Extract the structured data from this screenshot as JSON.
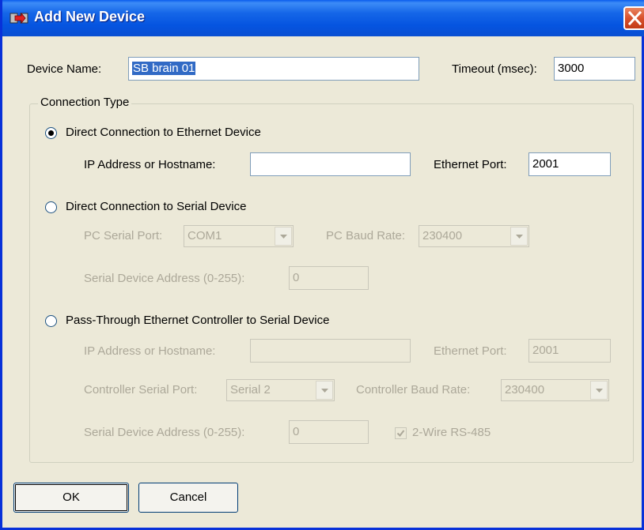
{
  "window": {
    "title": "Add New Device"
  },
  "device": {
    "name_label": "Device Name:",
    "name_value": "SB brain 01",
    "timeout_label": "Timeout (msec):",
    "timeout_value": "3000"
  },
  "connection_group": {
    "legend": "Connection Type",
    "direct_ethernet": {
      "label": "Direct Connection to Ethernet Device",
      "selected": true,
      "ip_label": "IP Address or Hostname:",
      "ip_value": "",
      "port_label": "Ethernet Port:",
      "port_value": "2001"
    },
    "direct_serial": {
      "label": "Direct Connection to Serial Device",
      "selected": false,
      "pc_port_label": "PC Serial Port:",
      "pc_port_value": "COM1",
      "baud_label": "PC Baud Rate:",
      "baud_value": "230400",
      "address_label": "Serial Device Address (0-255):",
      "address_value": "0"
    },
    "pass_through": {
      "label": "Pass-Through Ethernet Controller to Serial Device",
      "selected": false,
      "ip_label": "IP Address or Hostname:",
      "ip_value": "",
      "port_label": "Ethernet Port:",
      "port_value": "2001",
      "ctrl_port_label": "Controller Serial Port:",
      "ctrl_port_value": "Serial 2",
      "ctrl_baud_label": "Controller Baud Rate:",
      "ctrl_baud_value": "230400",
      "address_label": "Serial Device Address (0-255):",
      "address_value": "0",
      "two_wire_label": "2-Wire RS-485",
      "two_wire_checked": true
    }
  },
  "buttons": {
    "ok": "OK",
    "cancel": "Cancel"
  },
  "icons": {
    "title": "device-add-icon",
    "close": "close-icon"
  },
  "colors": {
    "title_bar": "#0a5ded",
    "close": "#d8512d",
    "selection": "#316ac5"
  }
}
